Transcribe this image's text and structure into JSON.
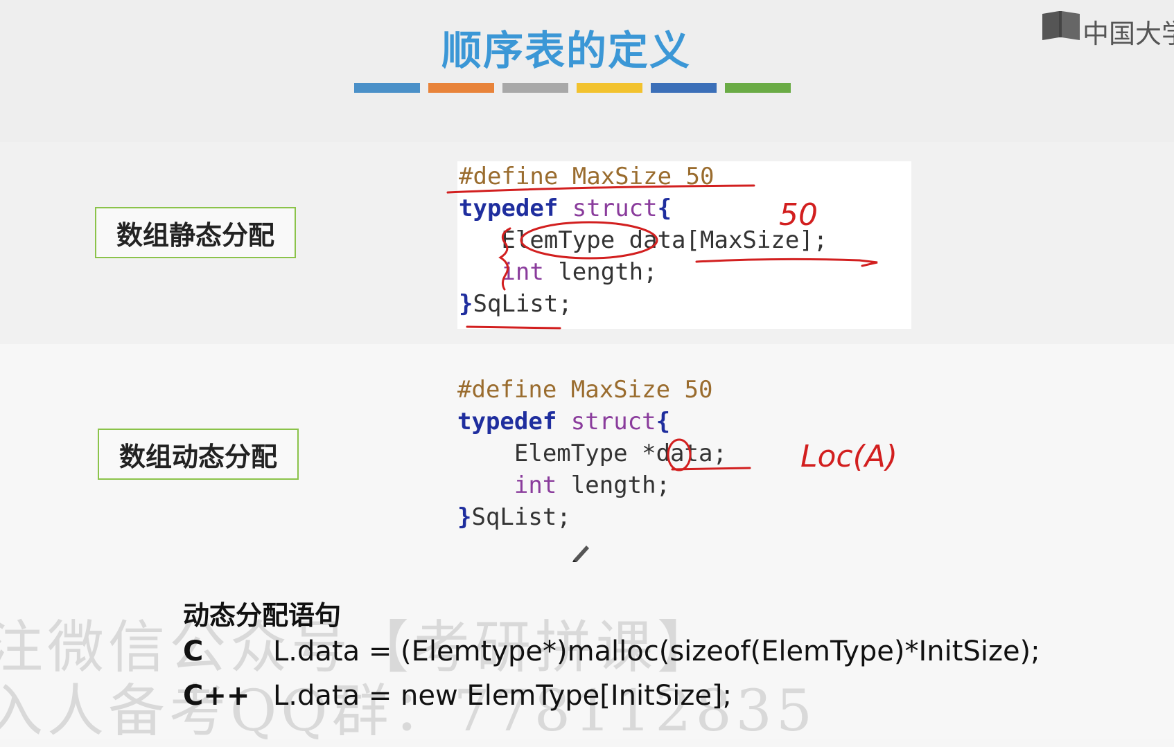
{
  "slide": {
    "title": "顺序表的定义",
    "title_color": "#3b97d6",
    "color_strip": [
      "#4a90c8",
      "#e8833a",
      "#a8a8a8",
      "#f2c22e",
      "#3b6fb8",
      "#6aab45"
    ]
  },
  "logo": {
    "text": "中国大学",
    "icon": "book-icon"
  },
  "sections": {
    "static": {
      "label": "数组静态分配",
      "code": {
        "line1": {
          "pp": "#define MaxSize 50"
        },
        "line2": {
          "kw": "typedef",
          "ty": "struct",
          "br": "{"
        },
        "line3": {
          "indent": "  ",
          "text": "ElemType data[MaxSize];"
        },
        "line4": {
          "ty": "int",
          "text": " length;"
        },
        "line5": {
          "br": "}",
          "text": "SqList;"
        }
      }
    },
    "dynamic": {
      "label": "数组动态分配",
      "code": {
        "line1": {
          "pp": "#define MaxSize 50"
        },
        "line2": {
          "kw": "typedef",
          "ty": "struct",
          "br": "{"
        },
        "line3": {
          "text": "ElemType *data;"
        },
        "line4": {
          "ty": "int",
          "text": " length;"
        },
        "line5": {
          "br": "}",
          "text": "SqList;"
        }
      }
    }
  },
  "annotations": {
    "static_note": "50",
    "dynamic_note": "Loc(A)"
  },
  "statements": {
    "heading": "动态分配语句",
    "c": {
      "lang": "C",
      "code": "L.data = (Elemtype*)malloc(sizeof(ElemType)*InitSize);"
    },
    "cpp": {
      "lang": "C++",
      "code": "L.data = new ElemType[InitSize];"
    }
  },
  "watermark": {
    "line1": "注微信公众号【考研拼课】",
    "line2": "入人备考QQ群：778112835"
  }
}
